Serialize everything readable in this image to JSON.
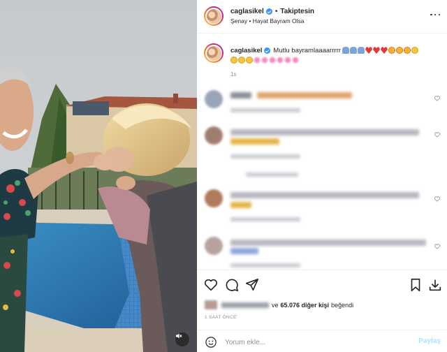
{
  "post": {
    "username": "caglasikel",
    "follow_label": "Takiptesin",
    "separator": "•",
    "music_label": "Şenay • Hayat Bayram Olsa",
    "verified": true
  },
  "caption": {
    "username": "caglasikel",
    "text": "Mutlu bayramlaaaarrrrr",
    "emoji_line1": [
      "pray",
      "pray",
      "pray",
      "heart",
      "heart",
      "heart",
      "face",
      "face",
      "face",
      "smile"
    ],
    "emoji_line2": [
      "smile",
      "smile",
      "smile",
      "flower",
      "flower",
      "flower",
      "flower",
      "flower",
      "flower"
    ],
    "time": "1s"
  },
  "likes": {
    "connector": "ve",
    "count_text": "65.076 diğer kişi",
    "suffix": "beğendi"
  },
  "post_time": "1 SAAT ÖNCE",
  "add_comment": {
    "placeholder": "Yorum ekle...",
    "post_label": "Paylaş"
  },
  "icons": [
    "more-icon",
    "heart-icon",
    "comment-icon",
    "share-icon",
    "bookmark-icon",
    "download-icon",
    "emoji-icon",
    "mute-icon"
  ],
  "colors": {
    "verified": "#3897f0",
    "post_button": "#b2dffc",
    "muted_text": "#8e8e8e"
  }
}
